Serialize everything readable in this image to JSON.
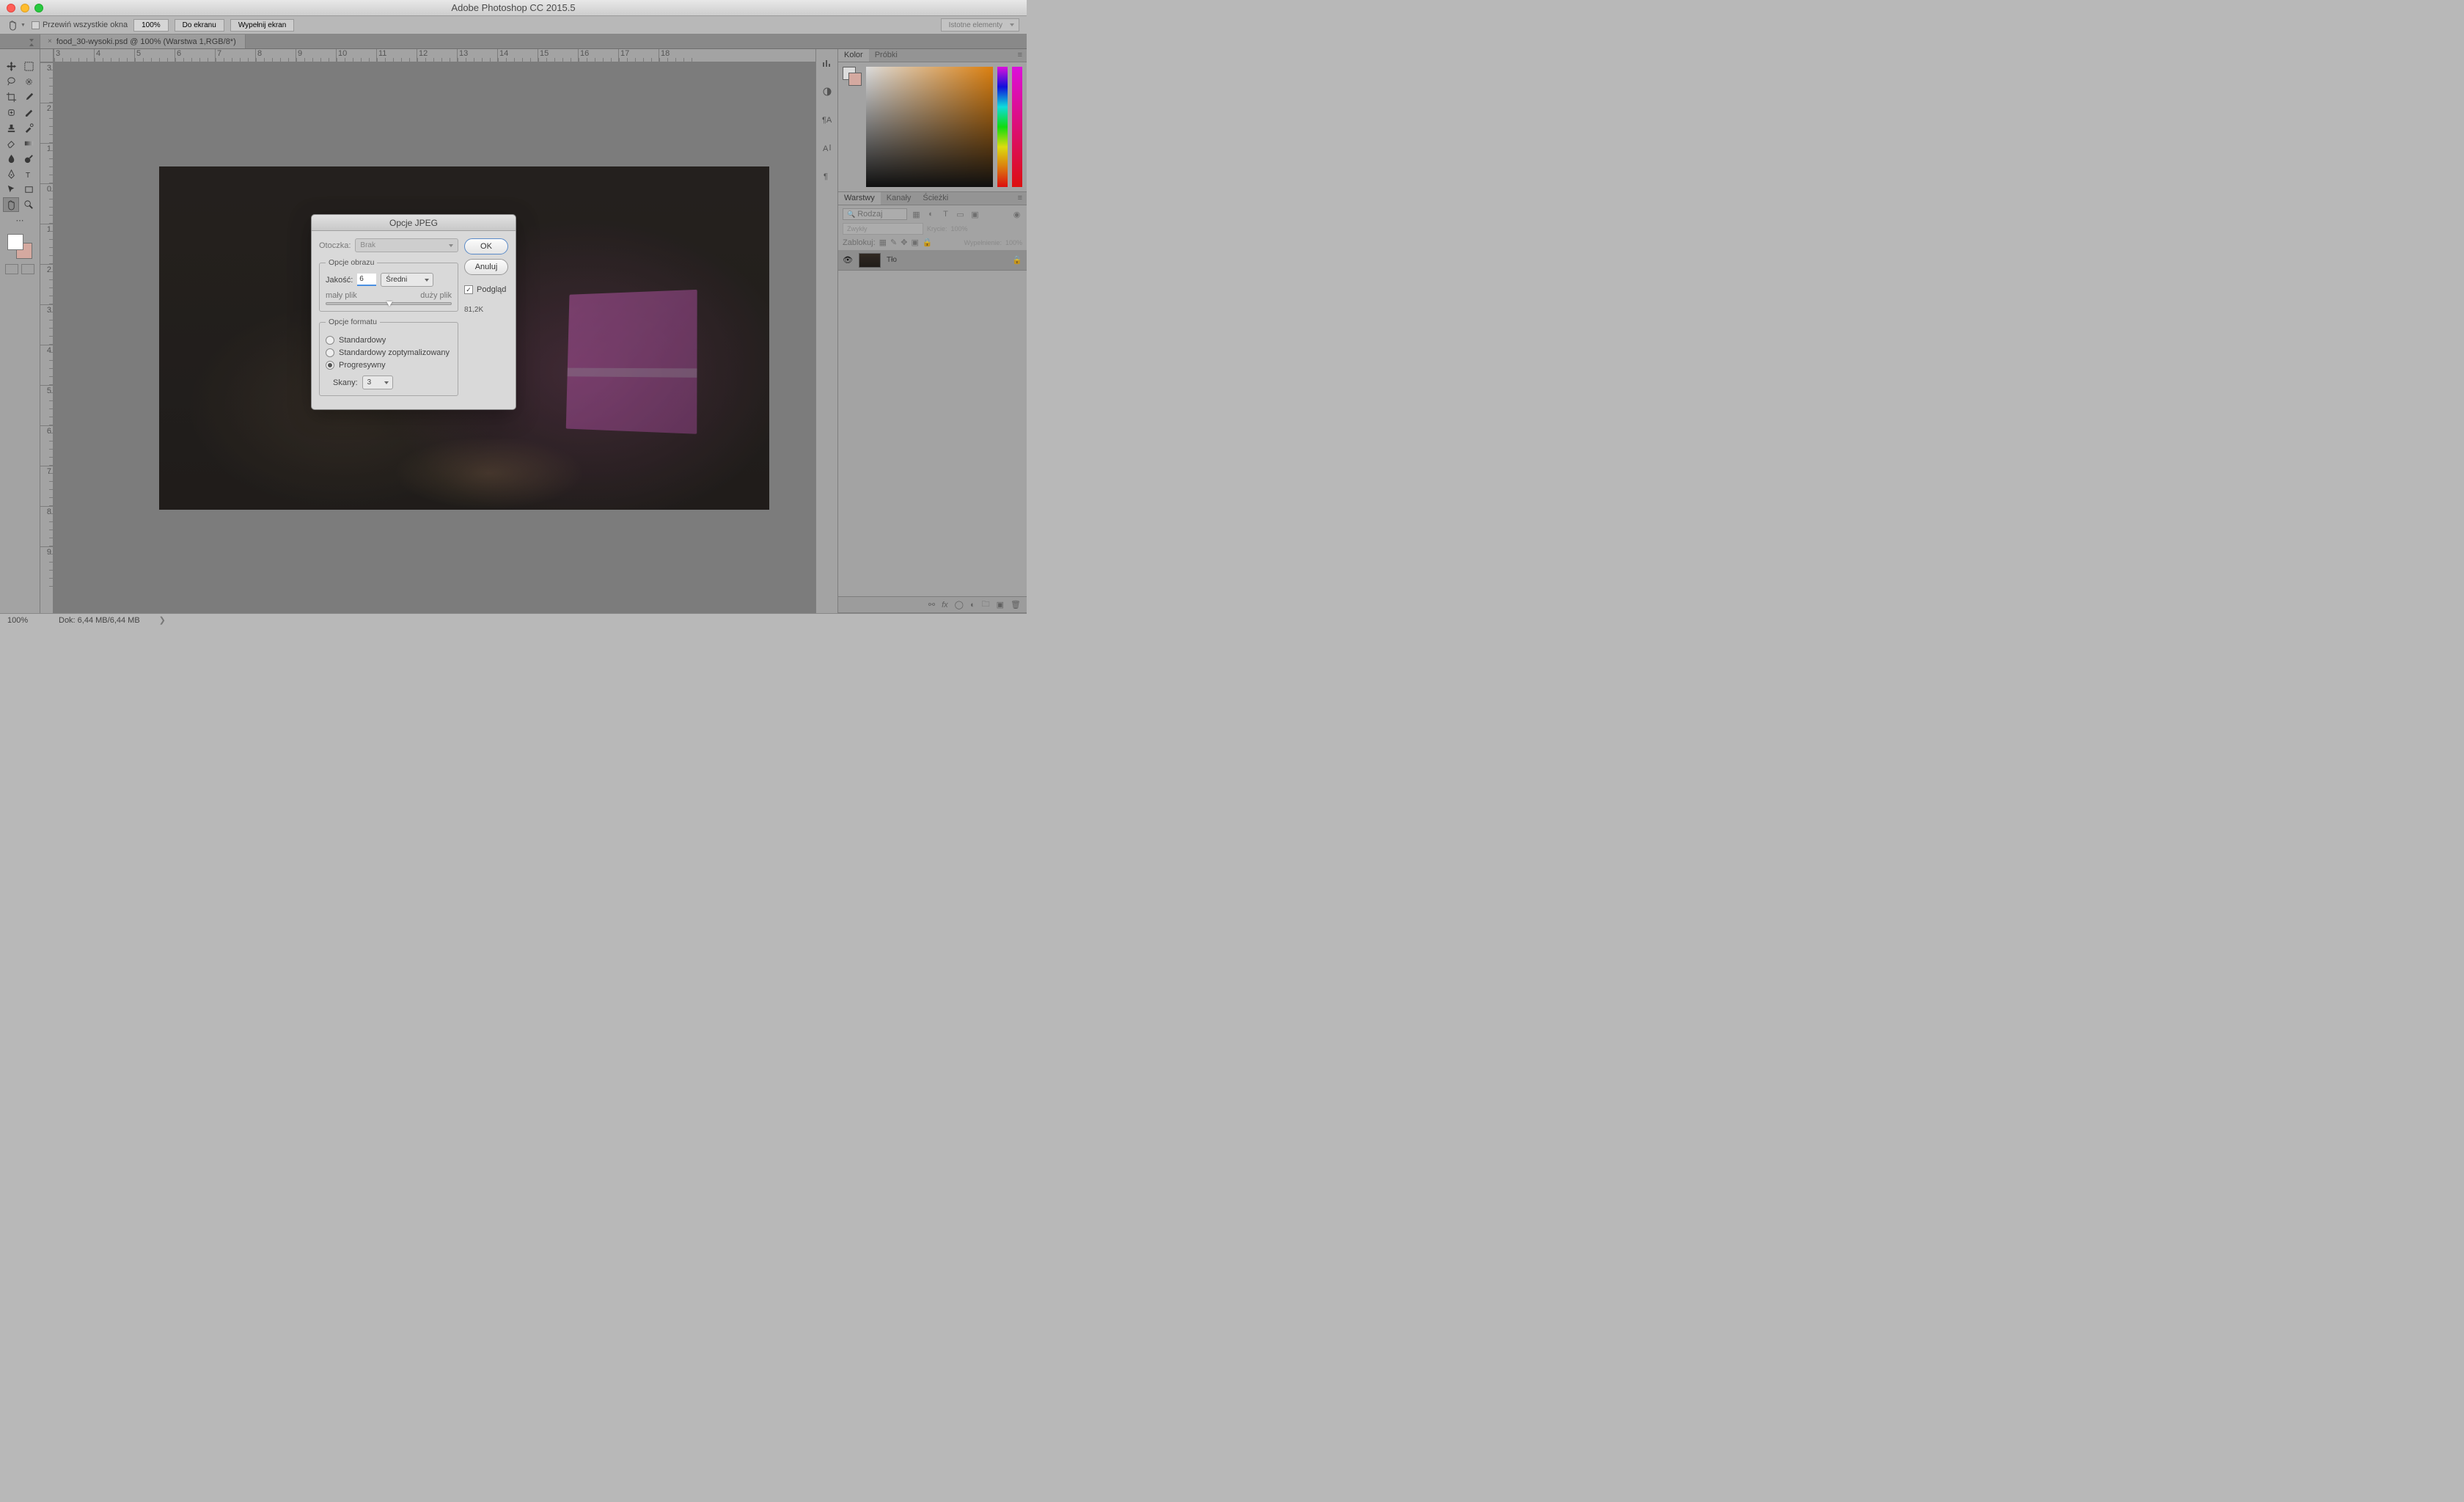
{
  "titlebar": {
    "app_title": "Adobe Photoshop CC 2015.5"
  },
  "optbar": {
    "scroll_all_label": "Przewiń wszystkie okna",
    "zoom_pct": "100%",
    "fit_screen": "Do ekranu",
    "fill_screen": "Wypełnij ekran",
    "workspace": "Istotne elementy"
  },
  "doctab": {
    "title": "food_30-wysoki.psd @ 100% (Warstwa 1,RGB/8*)"
  },
  "ruler_h": [
    "3",
    "4",
    "5",
    "6",
    "7",
    "8",
    "9",
    "10",
    "11",
    "12",
    "13",
    "14",
    "15",
    "16",
    "17",
    "18"
  ],
  "ruler_v": [
    "3",
    "2",
    "1",
    "0",
    "1",
    "2",
    "3",
    "4",
    "5",
    "6",
    "7",
    "8",
    "9"
  ],
  "panels": {
    "color_tab": "Kolor",
    "swatches_tab": "Próbki",
    "layers_tab": "Warstwy",
    "channels_tab": "Kanały",
    "paths_tab": "Ścieżki",
    "kind_label": "Rodzaj",
    "blend": "Zwykły",
    "opacity_label": "Krycie:",
    "opacity_val": "100%",
    "lock_label": "Zablokuj:",
    "fill_label": "Wypełnienie:",
    "fill_val": "100%",
    "layer_name": "Tło"
  },
  "status": {
    "zoom": "100%",
    "doc": "Dok: 6,44 MB/6,44 MB"
  },
  "dialog": {
    "title": "Opcje JPEG",
    "matte_label": "Otoczka:",
    "matte_value": "Brak",
    "image_opts_legend": "Opcje obrazu",
    "quality_label": "Jakość:",
    "quality_value": "6",
    "quality_preset": "Średni",
    "small_file": "mały plik",
    "large_file": "duży plik",
    "format_legend": "Opcje formatu",
    "radio_baseline": "Standardowy",
    "radio_optimized": "Standardowy zoptymalizowany",
    "radio_progressive": "Progresywny",
    "scans_label": "Skany:",
    "scans_value": "3",
    "ok": "OK",
    "cancel": "Anuluj",
    "preview": "Podgląd",
    "filesize": "81,2K"
  }
}
